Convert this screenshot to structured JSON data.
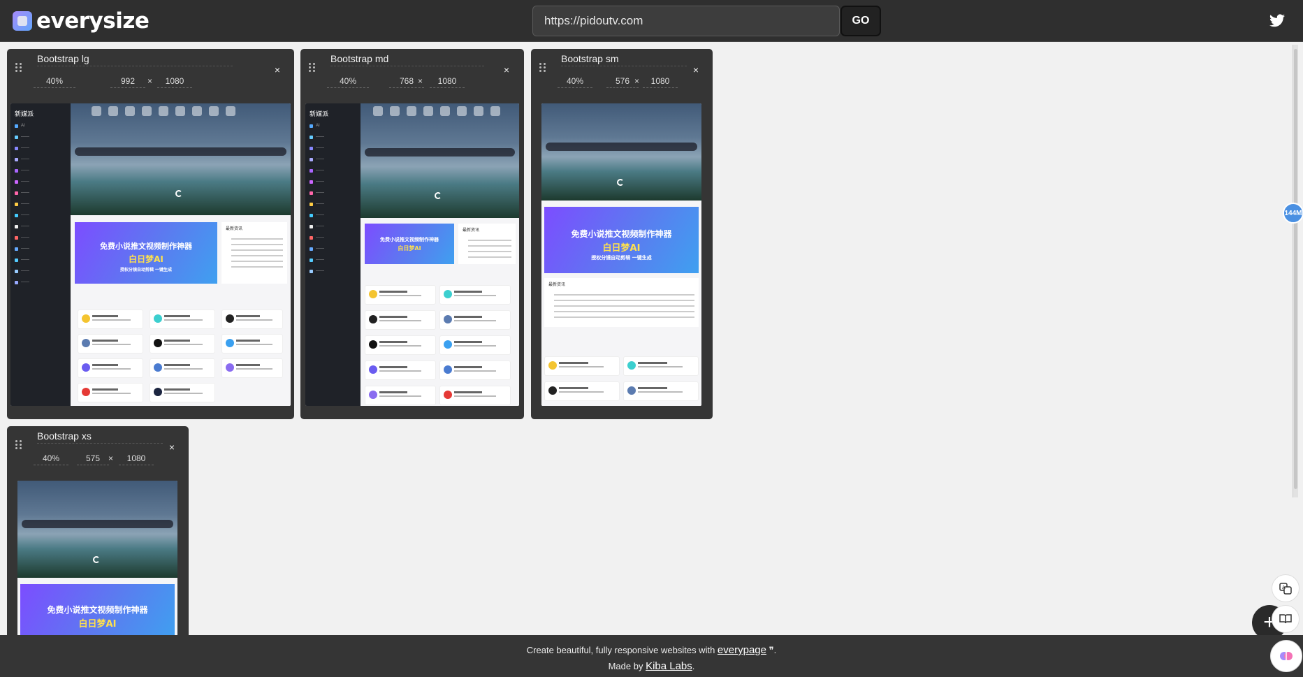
{
  "app": {
    "name": "everysize",
    "url_value": "https://pidoutv.com",
    "go_label": "GO",
    "social_icon": "twitter-icon"
  },
  "frames": [
    {
      "title": "Bootstrap lg",
      "scale": "40%",
      "width": "992",
      "height": "1080",
      "times": "×",
      "close": "×"
    },
    {
      "title": "Bootstrap md",
      "scale": "40%",
      "width": "768",
      "height": "1080",
      "times": "×",
      "close": "×"
    },
    {
      "title": "Bootstrap sm",
      "scale": "40%",
      "width": "576",
      "height": "1080",
      "times": "×",
      "close": "×"
    },
    {
      "title": "Bootstrap xs",
      "scale": "40%",
      "width": "575",
      "height": "1080",
      "times": "×",
      "close": "×"
    }
  ],
  "preview_site": {
    "brand": "新媒派",
    "banner_title": "免费小说推文视频制作神器",
    "banner_product": "白日梦AI",
    "banner_tagline": "授权分镜自动剪辑 一键生成",
    "list_title": "最新资讯",
    "tile_names": [
      "白日梦AI",
      "SeaArt",
      "AIPPT",
      "南哥小说推",
      "Kimi智能助手",
      "讯飞AI写作"
    ]
  },
  "widgets": {
    "badge_text": "144M"
  },
  "footer": {
    "line1_prefix": "Create beautiful, fully responsive websites with ",
    "line1_link": "everypage",
    "line1_suffix": " ❞.",
    "line2_prefix": "Made by ",
    "line2_link": "Kiba Labs",
    "line2_suffix": "."
  },
  "colors": {
    "header_bg": "#2f2f2f",
    "card_bg": "#353535",
    "page_bg": "#f1f1f1",
    "badge": "#4a90e2"
  }
}
